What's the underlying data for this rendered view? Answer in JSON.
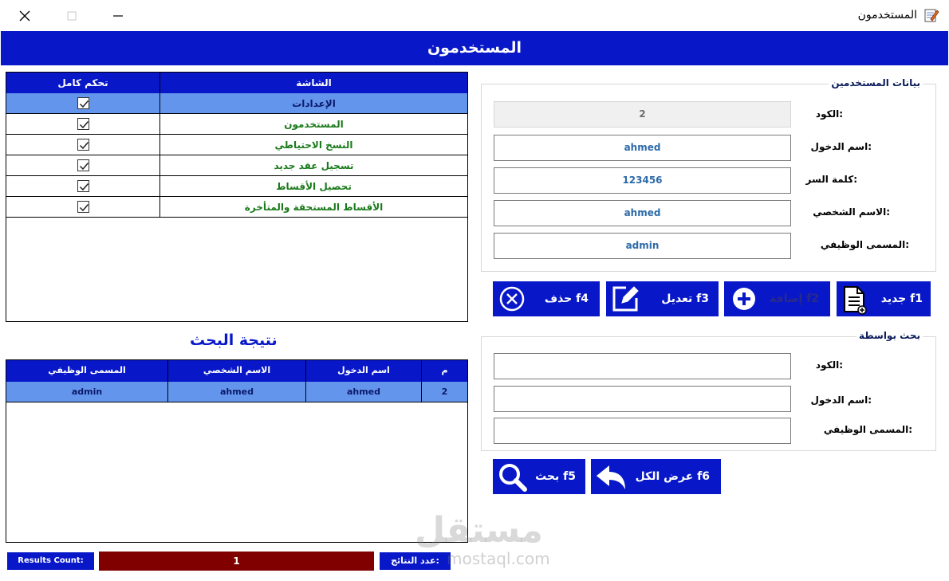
{
  "window": {
    "title": "المستخدمون"
  },
  "header": {
    "title": "المستخدمون"
  },
  "permissions": {
    "columns": {
      "screen": "الشاشة",
      "full_control": "تحكم كامل"
    },
    "rows": [
      {
        "screen": "الإعدادات",
        "checked": true,
        "selected": true
      },
      {
        "screen": "المستخدمون",
        "checked": true,
        "selected": false
      },
      {
        "screen": "النسخ الاحتياطي",
        "checked": true,
        "selected": false
      },
      {
        "screen": "تسجيل عقد جديد",
        "checked": true,
        "selected": false
      },
      {
        "screen": "تحصيل الأقساط",
        "checked": true,
        "selected": false
      },
      {
        "screen": "الأقساط المستحقة والمتأخرة",
        "checked": true,
        "selected": false
      }
    ]
  },
  "search_result": {
    "title": "نتيجة البحث",
    "columns": {
      "m": "م",
      "login": "اسم الدخول",
      "person": "الاسم الشخصي",
      "job": "المسمى الوظيفي"
    },
    "rows": [
      {
        "m": "2",
        "login": "ahmed",
        "person": "ahmed",
        "job": "admin"
      }
    ]
  },
  "results_count": {
    "label_en": "Results Count:",
    "value": "1",
    "label_ar": "عدد النتائج:"
  },
  "watermark": {
    "main": "مستقل",
    "sub": "mostaql.com"
  },
  "user_data": {
    "legend": "بيانات المستخدمين",
    "fields": {
      "code": {
        "label": "الكود:",
        "value": "2"
      },
      "login": {
        "label": "اسم الدخول:",
        "value": "ahmed"
      },
      "password": {
        "label": "كلمة السر:",
        "value": "123456"
      },
      "person_name": {
        "label": "الاسم الشخصي:",
        "value": "ahmed"
      },
      "job_title": {
        "label": "المسمى الوظيفي:",
        "value": "admin"
      }
    }
  },
  "actions": {
    "new": "جديد f1",
    "add": "إضافة f2",
    "edit": "تعديل f3",
    "delete": "حذف f4"
  },
  "search": {
    "legend": "بحث بواسطة",
    "fields": {
      "code": {
        "label": "الكود:",
        "value": ""
      },
      "login": {
        "label": "اسم الدخول:",
        "value": ""
      },
      "job_title": {
        "label": "المسمى الوظيفي:",
        "value": ""
      }
    },
    "show_all": "عرض الكل f6",
    "search_button": "بحث f5"
  },
  "colors": {
    "header_blue": "#0818c8",
    "selected_row": "#6495ed",
    "count_bg": "#800000",
    "green_text": "#1a7a1a"
  }
}
